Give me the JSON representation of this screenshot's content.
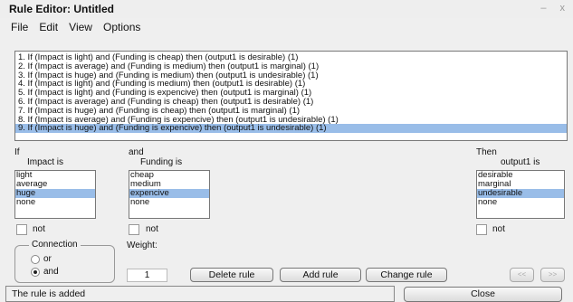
{
  "window": {
    "title": "Rule Editor: Untitled",
    "controls": "– x"
  },
  "menu": [
    "File",
    "Edit",
    "View",
    "Options"
  ],
  "rules": [
    "1. If (Impact is light) and (Funding is cheap) then (output1 is desirable) (1)",
    "2. If (Impact is average) and (Funding is medium) then (output1 is marginal) (1)",
    "3. If (Impact is huge) and (Funding is medium) then (output1 is undesirable) (1)",
    "4. If (Impact is light) and (Funding is medium) then (output1 is desirable) (1)",
    "5. If (Impact is light) and (Funding is expencive) then (output1 is marginal) (1)",
    "6. If (Impact is average) and (Funding is cheap) then (output1 is desirable) (1)",
    "7. If (Impact is huge) and (Funding is cheap) then (output1 is marginal) (1)",
    "8. If (Impact is average) and (Funding is expencive) then (output1 is undesirable) (1)",
    "9. If (Impact is huge) and (Funding is expencive) then (output1 is undesirable) (1)"
  ],
  "selected_rule": 8,
  "if_col": {
    "prefix": "If",
    "label": "Impact is",
    "items": [
      "light",
      "average",
      "huge",
      "none"
    ],
    "selected": 2,
    "not_label": "not"
  },
  "and_col": {
    "prefix": "and",
    "label": "Funding is",
    "items": [
      "cheap",
      "medium",
      "expencive",
      "none"
    ],
    "selected": 2,
    "not_label": "not"
  },
  "then_col": {
    "prefix": "Then",
    "label": "output1 is",
    "items": [
      "desirable",
      "marginal",
      "undesirable",
      "none"
    ],
    "selected": 2,
    "not_label": "not"
  },
  "connection": {
    "label": "Connection",
    "options": [
      "or",
      "and"
    ],
    "selected": "and"
  },
  "weight": {
    "label": "Weight:",
    "value": "1"
  },
  "buttons": {
    "delete": "Delete rule",
    "add": "Add rule",
    "change": "Change rule",
    "prev": "<<",
    "next": ">>",
    "close": "Close"
  },
  "status": "The rule is added"
}
